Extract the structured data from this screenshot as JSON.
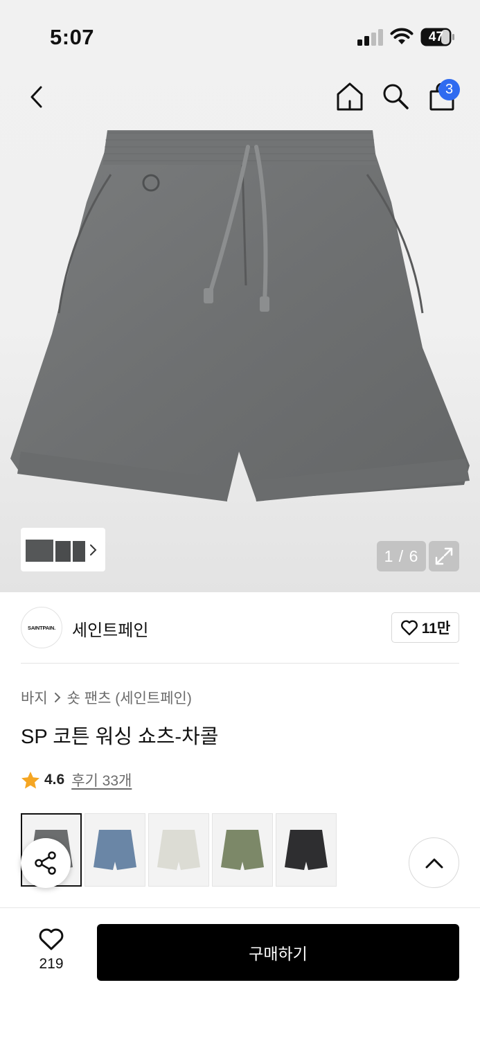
{
  "status_bar": {
    "time": "5:07",
    "battery": "47"
  },
  "nav": {
    "back_icon": "chevron-left-icon",
    "home_icon": "home-icon",
    "search_icon": "search-icon",
    "cart_icon": "bag-icon",
    "cart_count": "3"
  },
  "gallery": {
    "page_indicator": "1 / 6",
    "expand_icon": "expand-icon"
  },
  "brand": {
    "logo_text": "SAINTPAIN.",
    "name": "세인트페인",
    "likes": "11만"
  },
  "breadcrumb": {
    "category": "바지",
    "subcategory": "숏 팬츠 (세인트페인)"
  },
  "product": {
    "title": "SP 코튼 워싱 쇼츠-차콜",
    "rating": "4.6",
    "reviews": "후기 33개"
  },
  "colors": [
    {
      "name": "charcoal",
      "hex": "#6b6d6e",
      "selected": true
    },
    {
      "name": "blue",
      "hex": "#6a86a6",
      "selected": false
    },
    {
      "name": "ivory",
      "hex": "#dcdcd4",
      "selected": false
    },
    {
      "name": "khaki",
      "hex": "#7c8868",
      "selected": false
    },
    {
      "name": "black",
      "hex": "#2e2e30",
      "selected": false
    }
  ],
  "bottom": {
    "wish_count": "219",
    "buy_label": "구매하기"
  },
  "accent": {
    "badge": "#2f6bf0",
    "star": "#f5a623",
    "buy_bg": "#000000"
  }
}
